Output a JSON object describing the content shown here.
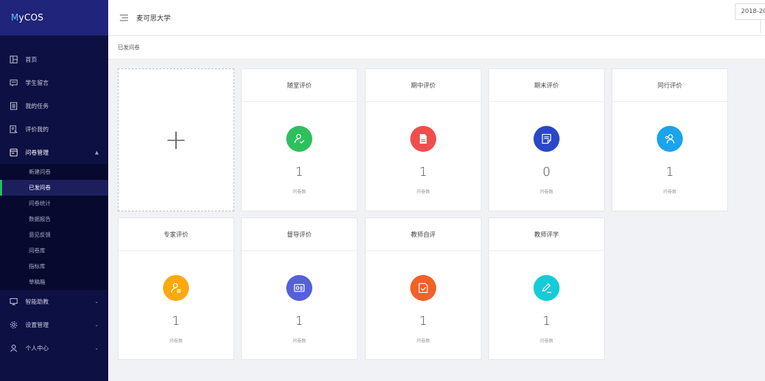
{
  "app": {
    "logo_prefix": "M",
    "logo_rest": "yCOS"
  },
  "header": {
    "school": "麦可思大学"
  },
  "breadcrumb": {
    "current": "已发问卷"
  },
  "year_filter": {
    "value": "2018-20"
  },
  "sidebar": {
    "items": [
      {
        "label": "首页",
        "icon": "home-icon"
      },
      {
        "label": "学生留言",
        "icon": "message-icon"
      },
      {
        "label": "我的任务",
        "icon": "task-list-icon"
      },
      {
        "label": "评价我的",
        "icon": "evaluation-icon"
      },
      {
        "label": "问卷管理",
        "icon": "survey-icon",
        "arrow": "▲"
      }
    ],
    "sub_items": [
      "新建问卷",
      "已发问卷",
      "问卷统计",
      "数据报告",
      "意见反馈",
      "问卷库",
      "指标库",
      "草稿箱"
    ],
    "bottom_items": [
      {
        "label": "智能助教",
        "icon": "monitor-icon",
        "arrow": "⌄"
      },
      {
        "label": "设置管理",
        "icon": "gear-icon",
        "arrow": "⌄"
      },
      {
        "label": "个人中心",
        "icon": "user-icon",
        "arrow": "⌄"
      }
    ]
  },
  "add_card": {
    "symbol": "+"
  },
  "cards": [
    {
      "title": "随堂评价",
      "count": "1",
      "count_label": "问卷数",
      "color": "#2ec05c",
      "icon": "user-check-icon"
    },
    {
      "title": "期中评价",
      "count": "1",
      "count_label": "问卷数",
      "color": "#f04e4e",
      "icon": "document-icon"
    },
    {
      "title": "期末评价",
      "count": "0",
      "count_label": "问卷数",
      "color": "#2a47c7",
      "icon": "notepad-icon"
    },
    {
      "title": "同行评价",
      "count": "1",
      "count_label": "问卷数",
      "color": "#1ba3ec",
      "icon": "users-icon"
    },
    {
      "title": "专家评价",
      "count": "1",
      "count_label": "问卷数",
      "color": "#fba90d",
      "icon": "expert-icon"
    },
    {
      "title": "督导评价",
      "count": "1",
      "count_label": "问卷数",
      "color": "#5561d8",
      "icon": "id-card-icon"
    },
    {
      "title": "教师自评",
      "count": "1",
      "count_label": "问卷数",
      "color": "#f26125",
      "icon": "self-check-icon"
    },
    {
      "title": "教师评学",
      "count": "1",
      "count_label": "问卷数",
      "color": "#15cbd8",
      "icon": "pen-icon"
    }
  ]
}
